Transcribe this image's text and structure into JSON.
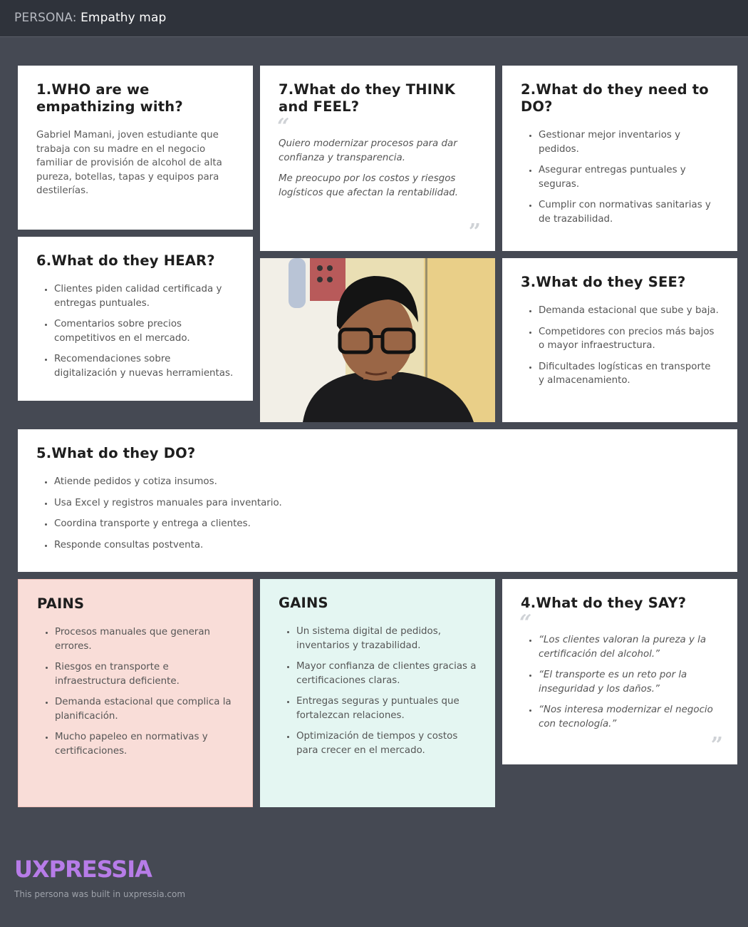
{
  "header": {
    "prefix": "PERSONA:",
    "title": "Empathy map"
  },
  "who": {
    "heading": "1.WHO are we empathizing with?",
    "text": "Gabriel Mamani, joven estudiante que trabaja con su madre en el negocio familiar de provisión de alcohol de alta pureza, botellas, tapas y equipos para destilerías."
  },
  "think": {
    "heading": "7.What do they THINK and FEEL?",
    "quotes": [
      "Quiero modernizar procesos para dar confianza y transparencia.",
      "Me preocupo por los costos y riesgos logísticos que afectan la rentabilidad."
    ]
  },
  "need": {
    "heading": "2.What do they need to DO?",
    "items": [
      "Gestionar mejor inventarios y pedidos.",
      "Asegurar entregas puntuales y seguras.",
      "Cumplir con normativas sanitarias y de trazabilidad."
    ]
  },
  "hear": {
    "heading": "6.What do they HEAR?",
    "items": [
      "Clientes piden calidad certificada y entregas puntuales.",
      "Comentarios sobre precios competitivos en el mercado.",
      "Recomendaciones sobre digitalización y nuevas herramientas."
    ]
  },
  "see": {
    "heading": "3.What do they SEE?",
    "items": [
      "Demanda estacional que sube y baja.",
      "Competidores con precios más bajos o mayor infraestructura.",
      "Dificultades logísticas en transporte y almacenamiento."
    ]
  },
  "do": {
    "heading": "5.What do they DO?",
    "items": [
      "Atiende pedidos y cotiza insumos.",
      "Usa Excel y registros manuales para inventario.",
      "Coordina transporte y entrega a clientes.",
      "Responde consultas postventa."
    ]
  },
  "pains": {
    "heading": "PAINS",
    "items": [
      "Procesos manuales que generan errores.",
      "Riesgos en transporte e infraestructura deficiente.",
      "Demanda estacional que complica la planificación.",
      "Mucho papeleo en normativas y certificaciones."
    ]
  },
  "gains": {
    "heading": "GAINS",
    "items": [
      "Un sistema digital de pedidos, inventarios y trazabilidad.",
      "Mayor confianza de clientes gracias a certificaciones claras.",
      "Entregas seguras y puntuales que fortalezcan relaciones.",
      "Optimización de tiempos y costos para crecer en el mercado."
    ]
  },
  "say": {
    "heading": "4.What do they SAY?",
    "items": [
      "“Los clientes valoran la pureza y la certificación del alcohol.”",
      "“El transporte es un reto por la inseguridad y los daños.”",
      "“Nos interesa modernizar el negocio con tecnología.”"
    ]
  },
  "footer": {
    "logo": "UXPRESSIA",
    "note": "This persona was built in uxpressia.com"
  },
  "colors": {
    "background": "#454953",
    "pains": "#f9ddd8",
    "gains": "#e4f6f2",
    "logo": "#b77ce8"
  }
}
